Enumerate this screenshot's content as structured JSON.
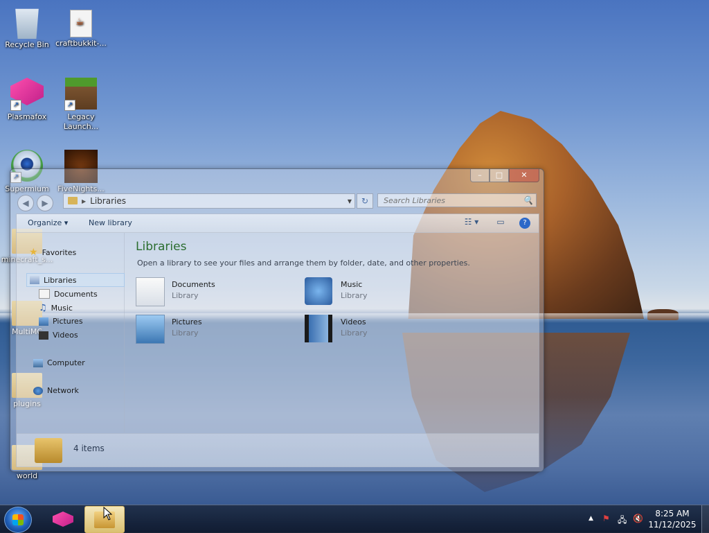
{
  "desktop": {
    "icons": [
      {
        "label": "Recycle Bin"
      },
      {
        "label": "craftbukkit-..."
      },
      {
        "label": "Plasmafox"
      },
      {
        "label": "Legacy Launch..."
      },
      {
        "label": "Supermium"
      },
      {
        "label": "FiveNights..."
      },
      {
        "label": "minecraft_s..."
      },
      {
        "label": "MultiMC"
      },
      {
        "label": "plugins"
      },
      {
        "label": "world"
      }
    ]
  },
  "window": {
    "caption": {
      "minimize": "–",
      "maximize": "□",
      "close": "✕"
    },
    "nav": {
      "back": "◀",
      "forward": "▶"
    },
    "address": {
      "path": "Libraries",
      "crumb_arrow": "▶",
      "dropdown": "▼"
    },
    "refresh": "↻",
    "search": {
      "placeholder": "Search Libraries",
      "icon": "🔍"
    },
    "toolbar": {
      "organize": "Organize ▾",
      "new_library": "New library",
      "view_icon": "☷ ▾",
      "preview_icon": "▭",
      "help_icon": "?"
    },
    "nav_pane": {
      "favorites": "Favorites",
      "libraries": "Libraries",
      "documents": "Documents",
      "music": "Music",
      "pictures": "Pictures",
      "videos": "Videos",
      "computer": "Computer",
      "network": "Network"
    },
    "content": {
      "title": "Libraries",
      "subtitle": "Open a library to see your files and arrange them by folder, date, and other properties.",
      "items": [
        {
          "name": "Documents",
          "type": "Library"
        },
        {
          "name": "Music",
          "type": "Library"
        },
        {
          "name": "Pictures",
          "type": "Library"
        },
        {
          "name": "Videos",
          "type": "Library"
        }
      ]
    },
    "details": {
      "count": "4 items"
    }
  },
  "taskbar": {
    "clock": {
      "time": "8:25 AM",
      "date": "11/12/2025"
    },
    "tray": {
      "arrow": "▲",
      "flag": "⚑",
      "network": "🖧",
      "volume": "🔇"
    }
  }
}
